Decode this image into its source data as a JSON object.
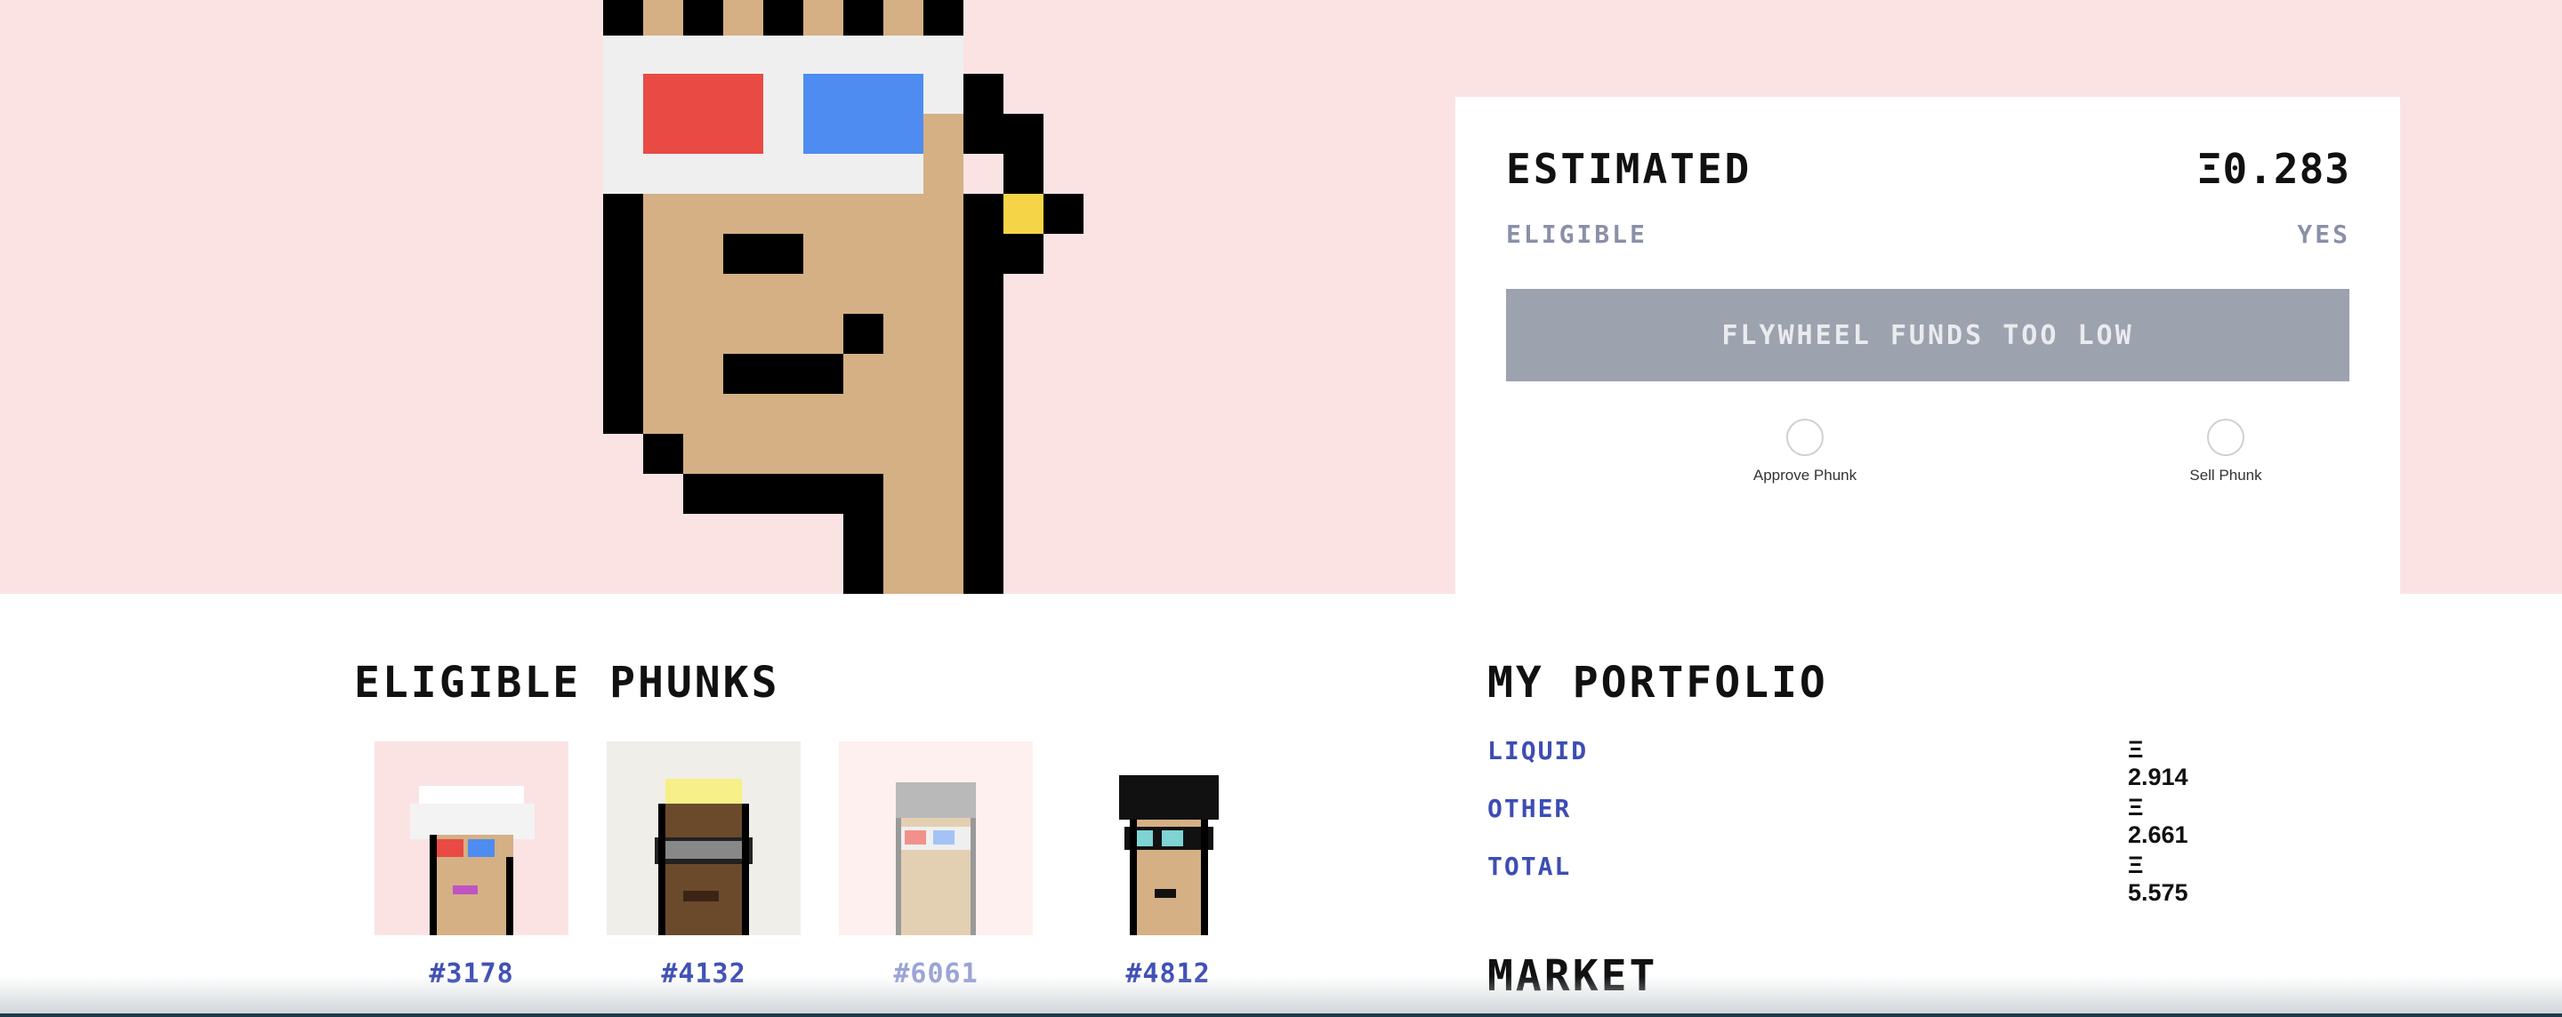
{
  "estimate": {
    "title": "ESTIMATED",
    "value": "Ξ0.283",
    "eligible_label": "ELIGIBLE",
    "eligible_value": "YES",
    "action_button": "FLYWHEEL FUNDS TOO LOW",
    "steps": [
      {
        "label": "Approve Phunk"
      },
      {
        "label": "Sell Phunk"
      }
    ]
  },
  "eligible": {
    "title": "ELIGIBLE PHUNKS",
    "phunks": [
      {
        "id": "#3178",
        "bg": "#fbe3e4"
      },
      {
        "id": "#4132",
        "bg": "#f0eee8"
      },
      {
        "id": "#6061",
        "bg": "#fdf0ef"
      },
      {
        "id": "#4812",
        "bg": "#ffffff"
      }
    ]
  },
  "portfolio": {
    "title": "MY PORTFOLIO",
    "rows": [
      {
        "label": "LIQUID",
        "value": "Ξ 2.914"
      },
      {
        "label": "OTHER",
        "value": "Ξ 2.661"
      },
      {
        "label": "TOTAL",
        "value": "Ξ 5.575"
      }
    ]
  },
  "market": {
    "title": "MARKET"
  },
  "colors": {
    "hero_bg": "#fbe3e4",
    "accent": "#3d4db3",
    "skin": "#d4b084",
    "glasses_red": "#e94a44",
    "glasses_blue": "#4e8cf1",
    "earring": "#f5d547",
    "button_disabled": "#9ca2ae"
  }
}
